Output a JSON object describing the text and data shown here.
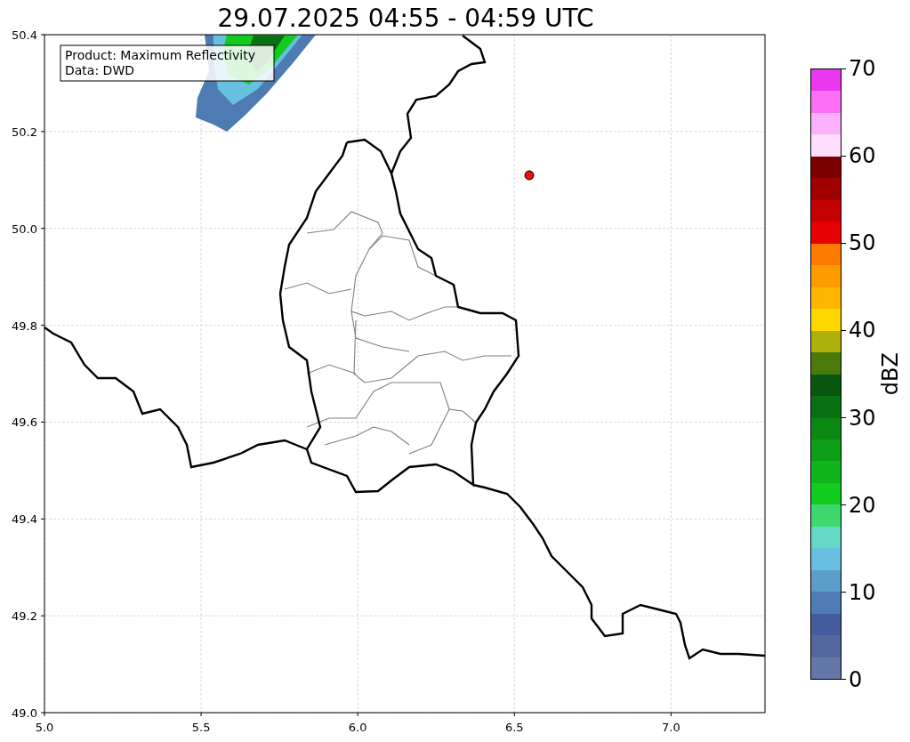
{
  "title": "29.07.2025 04:55 - 04:59 UTC",
  "info_box": [
    "Product: Maximum Reflectivity",
    "Data: DWD"
  ],
  "x_ticks": [
    "5.0",
    "5.5",
    "6.0",
    "6.5",
    "7.0"
  ],
  "y_ticks": [
    "50.4",
    "50.2",
    "50.0",
    "49.8",
    "49.6",
    "49.4",
    "49.2",
    "49.0"
  ],
  "colorbar": {
    "label": "dBZ",
    "ticks": [
      "70",
      "60",
      "50",
      "40",
      "30",
      "20",
      "10",
      "0"
    ],
    "segments": [
      {
        "color": "#ea38ee"
      },
      {
        "color": "#fc70f6"
      },
      {
        "color": "#fdb0fc"
      },
      {
        "color": "#ffddfd"
      },
      {
        "color": "#7d0000"
      },
      {
        "color": "#a10000"
      },
      {
        "color": "#c40000"
      },
      {
        "color": "#e60000"
      },
      {
        "color": "#fe7a00"
      },
      {
        "color": "#fe9b00"
      },
      {
        "color": "#fdb700"
      },
      {
        "color": "#fed700"
      },
      {
        "color": "#aeb00a"
      },
      {
        "color": "#4a7a0c"
      },
      {
        "color": "#07570e"
      },
      {
        "color": "#097013"
      },
      {
        "color": "#0b8814"
      },
      {
        "color": "#0c9e17"
      },
      {
        "color": "#0fb51b"
      },
      {
        "color": "#12cb1f"
      },
      {
        "color": "#3fd86e"
      },
      {
        "color": "#66d8c6"
      },
      {
        "color": "#67c0df"
      },
      {
        "color": "#5c9dca"
      },
      {
        "color": "#4d7bb2"
      },
      {
        "color": "#445b9d"
      },
      {
        "color": "#53679d"
      },
      {
        "color": "#6477a8"
      }
    ]
  }
}
